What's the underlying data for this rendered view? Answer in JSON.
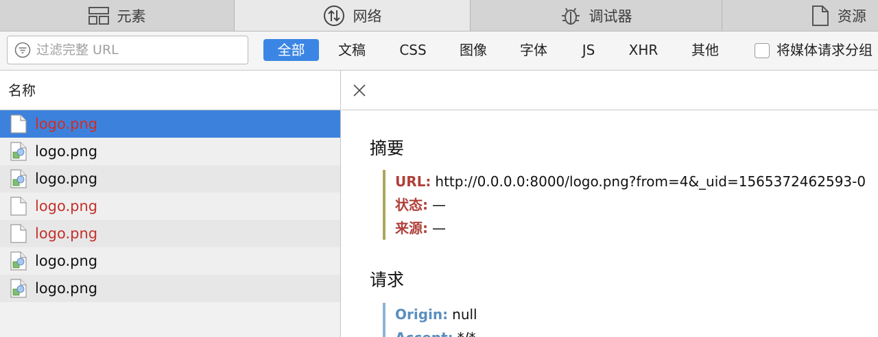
{
  "tabs": [
    {
      "label": "元素",
      "icon": "elements-icon"
    },
    {
      "label": "网络",
      "icon": "network-icon"
    },
    {
      "label": "调试器",
      "icon": "debugger-icon"
    },
    {
      "label": "资源",
      "icon": "resources-icon"
    }
  ],
  "filter": {
    "placeholder": "过滤完整 URL",
    "types": [
      "全部",
      "文稿",
      "CSS",
      "图像",
      "字体",
      "JS",
      "XHR",
      "其他"
    ],
    "active_type": "全部",
    "group_media_label": "将媒体请求分组"
  },
  "list": {
    "header": "名称",
    "rows": [
      {
        "name": "logo.png",
        "status": "error",
        "selected": true
      },
      {
        "name": "logo.png",
        "status": "ok",
        "selected": false
      },
      {
        "name": "logo.png",
        "status": "ok",
        "selected": false
      },
      {
        "name": "logo.png",
        "status": "error",
        "selected": false
      },
      {
        "name": "logo.png",
        "status": "error",
        "selected": false
      },
      {
        "name": "logo.png",
        "status": "ok",
        "selected": false
      },
      {
        "name": "logo.png",
        "status": "ok",
        "selected": false
      }
    ]
  },
  "detail": {
    "summary_title": "摘要",
    "summary": [
      {
        "key": "URL:",
        "value": "http://0.0.0.0:8000/logo.png?from=4&_uid=1565372462593-0"
      },
      {
        "key": "状态:",
        "value": "—"
      },
      {
        "key": "来源:",
        "value": "—"
      }
    ],
    "request_title": "请求",
    "request": [
      {
        "key": "Origin:",
        "value": "null"
      },
      {
        "key": "Accept:",
        "value": "*/*"
      }
    ]
  },
  "colors": {
    "accent": "#3b86e4",
    "error": "#c4312b",
    "selected_row": "#3c82dd"
  }
}
